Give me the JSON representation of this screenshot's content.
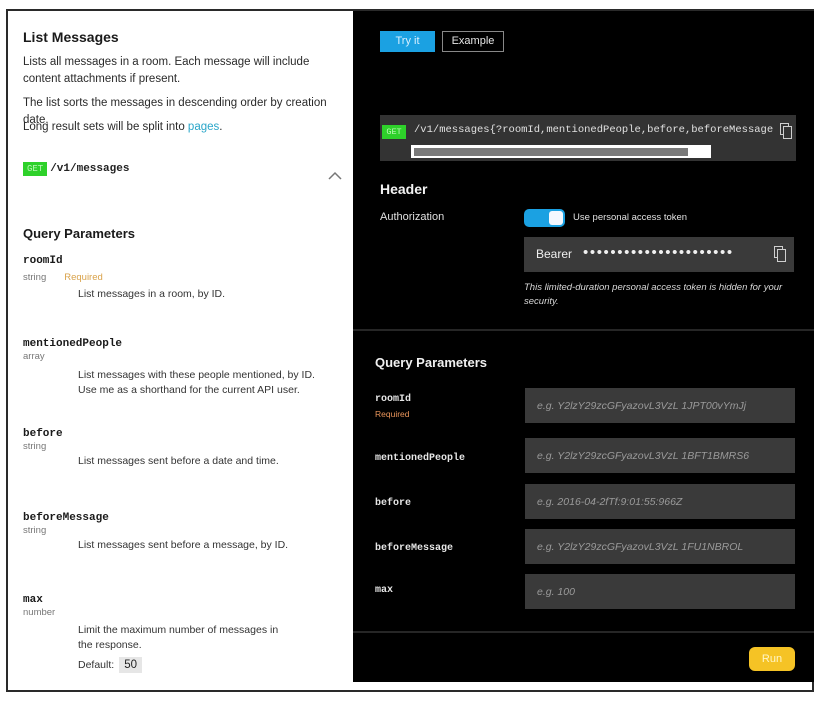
{
  "doc": {
    "title": "List Messages",
    "description_1": "Lists all messages in a room. Each message will include content attachments if present.",
    "description_2": "The list sorts the messages in descending order by creation date.",
    "description_3_prefix": "Long result sets will be split into ",
    "description_3_link": "pages",
    "description_3_suffix": ".",
    "method": "GET",
    "endpoint": "/v1/messages",
    "query_params_title": "Query Parameters",
    "params": [
      {
        "name": "roomId",
        "type": "string",
        "required": "Required",
        "description": "List messages in a room, by ID."
      },
      {
        "name": "mentionedPeople",
        "type": "array",
        "description": "List messages with these people mentioned, by ID.",
        "description_2": "Use me as a shorthand for the current API user."
      },
      {
        "name": "before",
        "type": "string",
        "description": "List messages sent before a date and time."
      },
      {
        "name": "beforeMessage",
        "type": "string",
        "description": "List messages sent before a message, by ID."
      },
      {
        "name": "max",
        "type": "number",
        "description": "Limit the maximum number of messages in the response.",
        "default_label": "Default:",
        "default_value": "50"
      }
    ]
  },
  "console": {
    "tabs": [
      {
        "label": "Try it",
        "active": true
      },
      {
        "label": "Example",
        "active": false
      }
    ],
    "request": {
      "method": "GET",
      "url": "/v1/messages{?roomId,mentionedPeople,before,beforeMessage"
    },
    "header": {
      "title": "Header",
      "authorization_label": "Authorization",
      "toggle_label": "Use personal access token",
      "toggle_on": true,
      "bearer_label": "Bearer",
      "bearer_masked": "••••••••••••••••••••••",
      "note": "This limited-duration personal access token is hidden for your security."
    },
    "query": {
      "title": "Query Parameters",
      "fields": [
        {
          "name": "roomId",
          "required": "Required",
          "placeholder": "e.g. Y2lzY29zcGFyazovL3VzL 1JPT00vYmJj",
          "value": ""
        },
        {
          "name": "mentionedPeople",
          "placeholder": "e.g. Y2lzY29zcGFyazovL3VzL 1BFT1BMRS6",
          "value": ""
        },
        {
          "name": "before",
          "placeholder": "e.g. 2016-04-2fTf:9:01:55:966Z",
          "value": ""
        },
        {
          "name": "beforeMessage",
          "placeholder": "e.g. Y2lzY29zcGFyazovL3VzL 1FU1NBROL",
          "value": ""
        },
        {
          "name": "max",
          "placeholder": "e.g. 100",
          "value": ""
        }
      ]
    },
    "run_label": "Run"
  },
  "colors": {
    "accent_blue": "#1ba1e2",
    "get_green": "#2ed12a",
    "run_yellow": "#f5c325",
    "required_orange": "#d9a24a",
    "link_teal": "#2aa6c9"
  },
  "icons": {
    "collapse": "chevron-up-icon",
    "copy": "copy-icon"
  }
}
